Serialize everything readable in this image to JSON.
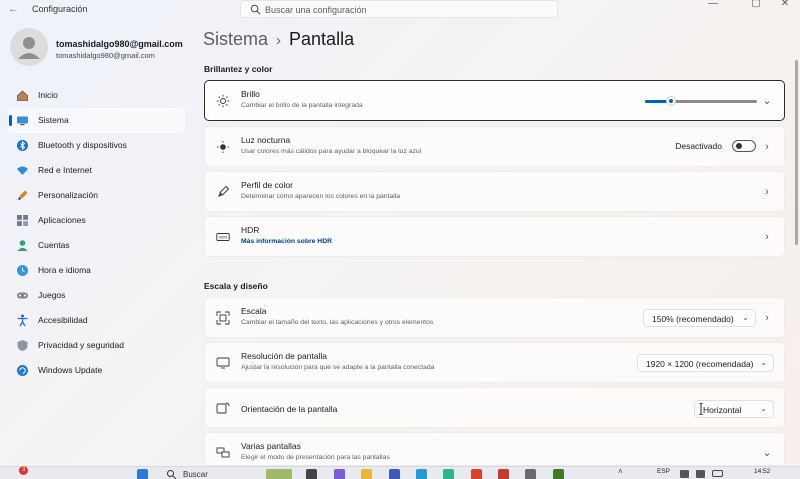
{
  "window": {
    "title": "Configuración",
    "back_glyph": "←",
    "controls": {
      "minimize": "—",
      "maximize": "▢",
      "close": "✕"
    }
  },
  "search": {
    "placeholder": "Buscar una configuración"
  },
  "profile": {
    "name": "tomashidalgo980@gmail.com",
    "email": "tomashidalgo980@gmail.com"
  },
  "sidebar": {
    "items": [
      {
        "label": "Inicio",
        "icon": "home-icon"
      },
      {
        "label": "Sistema",
        "icon": "display-icon",
        "active": true
      },
      {
        "label": "Bluetooth y dispositivos",
        "icon": "bluetooth-icon"
      },
      {
        "label": "Red e Internet",
        "icon": "wifi-icon"
      },
      {
        "label": "Personalización",
        "icon": "brush-icon"
      },
      {
        "label": "Aplicaciones",
        "icon": "apps-icon"
      },
      {
        "label": "Cuentas",
        "icon": "person-icon"
      },
      {
        "label": "Hora e idioma",
        "icon": "globe-clock-icon"
      },
      {
        "label": "Juegos",
        "icon": "gamepad-icon"
      },
      {
        "label": "Accesibilidad",
        "icon": "accessibility-icon"
      },
      {
        "label": "Privacidad y seguridad",
        "icon": "shield-icon"
      },
      {
        "label": "Windows Update",
        "icon": "update-icon"
      }
    ]
  },
  "breadcrumb": {
    "parent": "Sistema",
    "separator": "›",
    "current": "Pantalla"
  },
  "sections": {
    "brightness_color": {
      "title": "Brillantez y color",
      "brightness": {
        "title": "Brillo",
        "subtitle": "Cambiar el brillo de la pantalla integrada",
        "level_percent": 23
      },
      "night_light": {
        "title": "Luz nocturna",
        "subtitle": "Usar colores más cálidos para ayudar a bloquear la luz azul",
        "state": "Desactivado"
      },
      "color_profile": {
        "title": "Perfil de color",
        "subtitle": "Determinar cómo aparecen los colores en la pantalla"
      },
      "hdr": {
        "title": "HDR",
        "subtitle": "Más información sobre HDR"
      }
    },
    "scale_layout": {
      "title": "Escala y diseño",
      "scale": {
        "title": "Escala",
        "subtitle": "Cambiar el tamaño del texto, las aplicaciones y otros elementos",
        "value": "150% (recomendado)"
      },
      "resolution": {
        "title": "Resolución de pantalla",
        "subtitle": "Ajustar la resolución para que se adapte a la pantalla conectada",
        "value": "1920 × 1200 (recomendada)"
      },
      "orientation": {
        "title": "Orientación de la pantalla",
        "value": "Horizontal"
      },
      "multiple": {
        "title": "Varias pantallas",
        "subtitle": "Elegir el modo de presentación para las pantallas"
      }
    }
  },
  "taskbar": {
    "search_label": "Buscar",
    "language": "ESP",
    "time": "14:52",
    "notification_count": "3"
  },
  "colors": {
    "accent": "#005fb8",
    "link": "#003e92"
  }
}
